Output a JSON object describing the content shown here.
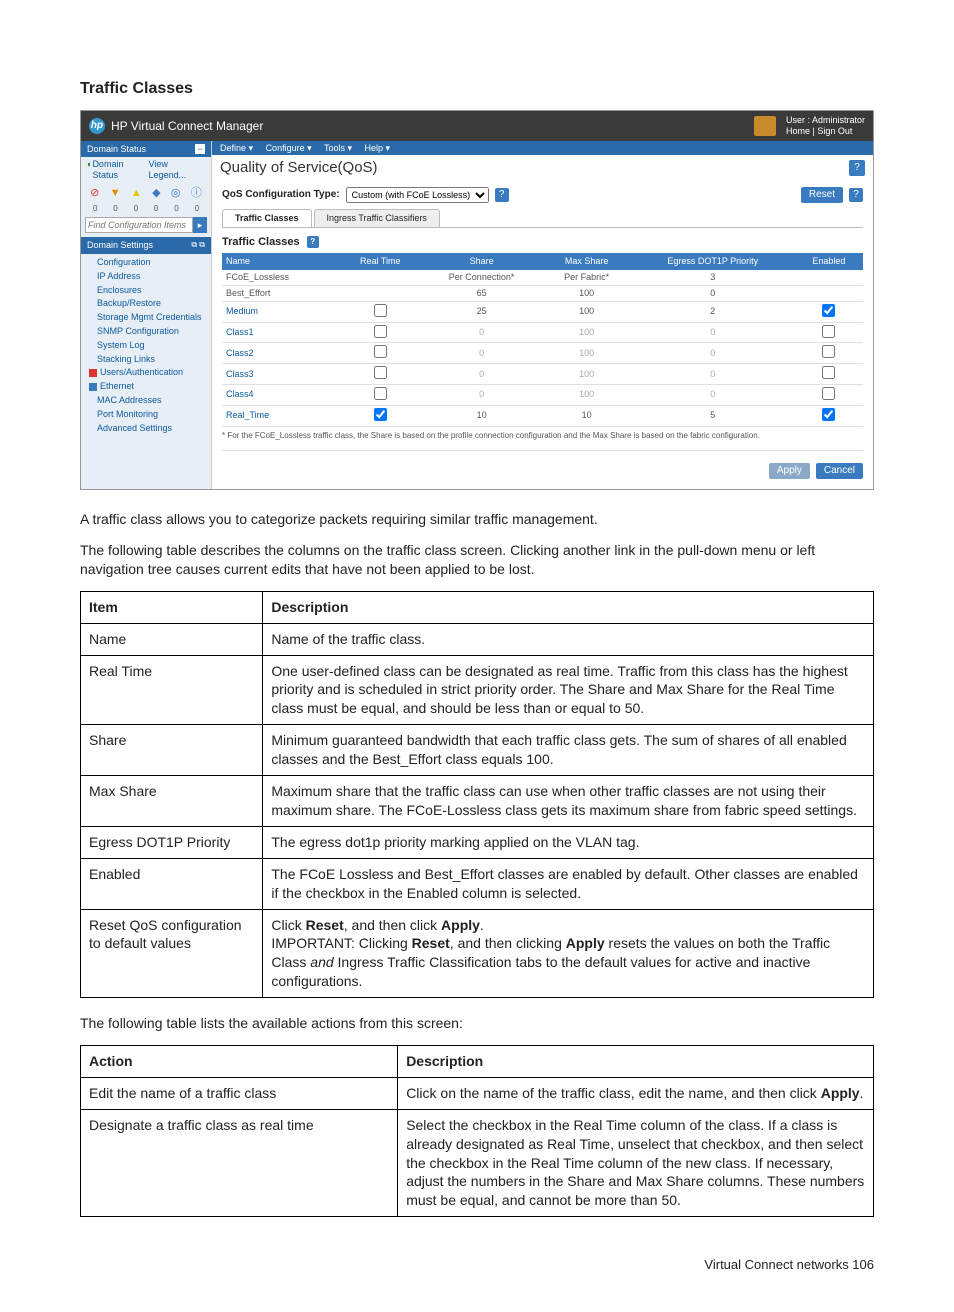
{
  "page": {
    "heading": "Traffic Classes",
    "footer": "Virtual Connect networks   106"
  },
  "screenshot": {
    "titlebar": {
      "title": "HP Virtual Connect Manager",
      "user_label": "User : Administrator",
      "links": "Home | Sign Out"
    },
    "menubar": {
      "define": "Define ▾",
      "configure": "Configure ▾",
      "tools": "Tools ▾",
      "help": "Help ▾"
    },
    "left_panel": {
      "domain_status_hdr": "Domain Status",
      "domain_status_link": "Domain Status",
      "view_legend_link": "View Legend...",
      "find_placeholder": "Find Configuration Items",
      "domain_settings_hdr": "Domain Settings",
      "tree": [
        "Configuration",
        "IP Address",
        "Enclosures",
        "Backup/Restore",
        "Storage Mgmt Credentials",
        "SNMP Configuration",
        "System Log",
        "Stacking Links",
        "Users/Authentication",
        "Ethernet",
        "MAC Addresses",
        "Port Monitoring",
        "Advanced Settings"
      ],
      "icon_counts": {
        "r": "0",
        "t1": "0",
        "t2": "0",
        "s": "0",
        "c": "0",
        "i": "0"
      }
    },
    "content": {
      "page_title": "Quality of Service(QoS)",
      "config_type_label": "QoS Configuration Type:",
      "config_type_value": "Custom (with FCoE Lossless)",
      "reset_label": "Reset",
      "tab_tc": "Traffic Classes",
      "tab_ing": "Ingress Traffic Classifiers",
      "sub_title": "Traffic Classes",
      "table": {
        "headers": {
          "name": "Name",
          "real_time": "Real Time",
          "share": "Share",
          "max_share": "Max Share",
          "egress": "Egress DOT1P Priority",
          "enabled": "Enabled"
        },
        "rows": [
          {
            "name": "FCoE_Lossless",
            "rt": "",
            "share": "Per Connection*",
            "max_share": "Per Fabric*",
            "egress": "3",
            "enabled": "",
            "dim": false,
            "link": false
          },
          {
            "name": "Best_Effort",
            "rt": "",
            "share": "65",
            "max_share": "100",
            "egress": "0",
            "enabled": "",
            "dim": false,
            "link": false
          },
          {
            "name": "Medium",
            "rt": "unchecked",
            "share": "25",
            "max_share": "100",
            "egress": "2",
            "enabled": "checked",
            "dim": false,
            "link": true
          },
          {
            "name": "Class1",
            "rt": "unchecked",
            "share": "0",
            "max_share": "100",
            "egress": "0",
            "enabled": "unchecked",
            "dim": true,
            "link": true
          },
          {
            "name": "Class2",
            "rt": "unchecked",
            "share": "0",
            "max_share": "100",
            "egress": "0",
            "enabled": "unchecked",
            "dim": true,
            "link": true
          },
          {
            "name": "Class3",
            "rt": "unchecked",
            "share": "0",
            "max_share": "100",
            "egress": "0",
            "enabled": "unchecked",
            "dim": true,
            "link": true
          },
          {
            "name": "Class4",
            "rt": "unchecked",
            "share": "0",
            "max_share": "100",
            "egress": "0",
            "enabled": "unchecked",
            "dim": true,
            "link": true
          },
          {
            "name": "Real_Time",
            "rt": "checked",
            "share": "10",
            "max_share": "10",
            "egress": "5",
            "enabled": "checked",
            "dim": false,
            "link": true
          }
        ]
      },
      "footnote": "* For the FCoE_Lossless traffic class, the Share is based on the profile connection configuration and the Max Share is based on the fabric configuration.",
      "apply_label": "Apply",
      "cancel_label": "Cancel"
    }
  },
  "body_paragraphs": {
    "p1": "A traffic class allows you to categorize packets requiring similar traffic management.",
    "p2": "The following table describes the columns on the traffic class screen. Clicking another link in the pull-down menu or left navigation tree causes current edits that have not been applied to be lost.",
    "p3": "The following table lists the available actions from this screen:"
  },
  "desc_table": {
    "col_item": "Item",
    "col_desc": "Description",
    "rows": [
      {
        "item": "Name",
        "desc": "Name of the traffic class."
      },
      {
        "item": "Real Time",
        "desc": "One user-defined class can be designated as real time. Traffic from this class has the highest priority and is scheduled in strict priority order. The Share and Max Share for the Real Time class must be equal, and should be less than or equal to 50."
      },
      {
        "item": "Share",
        "desc": "Minimum guaranteed bandwidth that each traffic class gets. The sum of shares of all enabled classes and the Best_Effort class equals 100."
      },
      {
        "item": "Max Share",
        "desc": "Maximum share that the traffic class can use when other traffic classes are not using their maximum share. The FCoE-Lossless class gets its maximum share from fabric speed settings."
      },
      {
        "item": "Egress DOT1P Priority",
        "desc": "The egress dot1p priority marking applied on the VLAN tag."
      },
      {
        "item": "Enabled",
        "desc": "The FCoE Lossless and Best_Effort classes are enabled by default. Other classes are enabled if the checkbox in the Enabled column is selected."
      },
      {
        "item": "Reset QoS configuration to default values",
        "desc_html": true,
        "desc": "Click <b>Reset</b>, and then click <b>Apply</b>.<br>IMPORTANT: Clicking <b>Reset</b>, and then clicking <b>Apply</b> resets the values on both the Traffic Class <i>and</i> Ingress Traffic Classification tabs to the default values for active and inactive configurations."
      }
    ]
  },
  "action_table": {
    "col_action": "Action",
    "col_desc": "Description",
    "rows": [
      {
        "action": "Edit the name of a traffic class",
        "desc_html": true,
        "desc": "Click on the name of the traffic class, edit the name, and then click <b>Apply</b>."
      },
      {
        "action": "Designate a traffic class as real time",
        "desc": "Select the checkbox in the Real Time column of the class. If a class is already designated as Real Time, unselect that checkbox, and then select the checkbox in the Real Time column of the new class. If necessary, adjust the numbers in the Share and Max Share columns. These numbers must be equal, and cannot be more than 50."
      }
    ]
  }
}
